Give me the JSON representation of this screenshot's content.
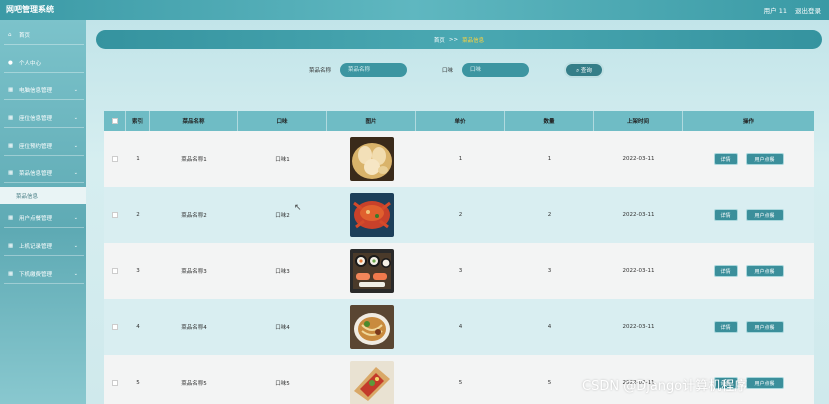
{
  "header": {
    "title": "网吧管理系统",
    "user": "用户 11",
    "logout": "退出登录"
  },
  "sidebar": {
    "items": [
      {
        "label": "首页",
        "icon": "home-icon",
        "glyph": "⌂"
      },
      {
        "label": "个人中心",
        "icon": "person-icon",
        "glyph": "●"
      },
      {
        "label": "电脑信息管理",
        "icon": "grid-icon",
        "glyph": "▦"
      },
      {
        "label": "座位信息管理",
        "icon": "grid-icon",
        "glyph": "▦"
      },
      {
        "label": "座位预约管理",
        "icon": "grid-icon",
        "glyph": "▦"
      },
      {
        "label": "菜品信息管理",
        "icon": "grid-icon",
        "glyph": "▦"
      },
      {
        "label": "用户点餐管理",
        "icon": "grid-icon",
        "glyph": "▦"
      },
      {
        "label": "上机记录管理",
        "icon": "grid-icon",
        "glyph": "▦"
      },
      {
        "label": "下机缴费管理",
        "icon": "grid-icon",
        "glyph": "▦"
      }
    ],
    "subitem": "菜品信息",
    "arrow": "⌄"
  },
  "breadcrumb": {
    "home": "首页",
    "sep": ">>",
    "current": "菜品信息"
  },
  "search": {
    "name_label": "菜品名称",
    "name_placeholder": "菜品名称",
    "flavor_label": "口味",
    "flavor_placeholder": "口味",
    "button": "⌕ 查询"
  },
  "table": {
    "headers": [
      "索引",
      "菜品名称",
      "口味",
      "图片",
      "单价",
      "数量",
      "上架时间",
      "操作"
    ],
    "rows": [
      {
        "index": "1",
        "name": "菜品名称1",
        "flavor": "口味1",
        "price": "1",
        "qty": "1",
        "date": "2022-03-11",
        "food": "dumplings"
      },
      {
        "index": "2",
        "name": "菜品名称2",
        "flavor": "口味2",
        "price": "2",
        "qty": "2",
        "date": "2022-03-11",
        "food": "crab"
      },
      {
        "index": "3",
        "name": "菜品名称3",
        "flavor": "口味3",
        "price": "3",
        "qty": "3",
        "date": "2022-03-11",
        "food": "sushi"
      },
      {
        "index": "4",
        "name": "菜品名称4",
        "flavor": "口味4",
        "price": "4",
        "qty": "4",
        "date": "2022-03-11",
        "food": "noodles"
      },
      {
        "index": "5",
        "name": "菜品名称5",
        "flavor": "口味5",
        "price": "5",
        "qty": "5",
        "date": "2022-03-11",
        "food": "wrap"
      }
    ],
    "detail_btn": "详情",
    "order_btn": "用户点餐"
  },
  "watermark": "CSDN @Django计算机程序",
  "colors": {
    "accent": "#3b8f9b",
    "header_bg": "#4aa8b2",
    "breadcrumb_current": "#ffd43b"
  }
}
